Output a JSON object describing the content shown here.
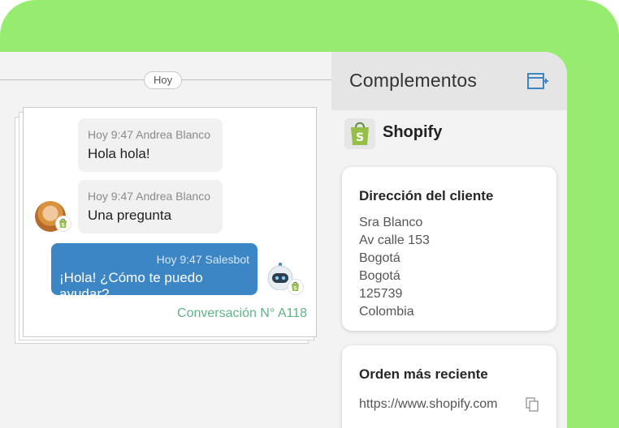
{
  "chat": {
    "date_label": "Hoy",
    "messages": [
      {
        "meta": "Hoy 9:47 Andrea Blanco",
        "text": "Hola hola!"
      },
      {
        "meta": "Hoy 9:47 Andrea Blanco",
        "text": "Una pregunta"
      },
      {
        "meta": "Hoy 9:47 Salesbot",
        "text": "¡Hola! ¿Cómo te puedo ayudar?"
      }
    ],
    "conversation_label": "Conversación N° A118"
  },
  "panel": {
    "title": "Complementos",
    "integration_name": "Shopify",
    "address_card": {
      "title": "Dirección del cliente",
      "lines": [
        "Sra Blanco",
        "Av calle 153",
        "Bogotá",
        "Bogotá",
        "125739",
        "Colombia"
      ]
    },
    "order_card": {
      "title": "Orden más reciente",
      "link": "https://www.shopify.com"
    }
  },
  "colors": {
    "background_green": "#96ec6e",
    "bot_bubble": "#3d86c6",
    "accent_blue": "#3d86c6",
    "conversation_label": "#5fb288",
    "shopify_green": "#95bf47"
  },
  "icons": {
    "add": "add-panel-icon",
    "copy": "copy-icon",
    "shopify": "shopify-bag-icon",
    "bot": "bot-avatar-icon"
  }
}
